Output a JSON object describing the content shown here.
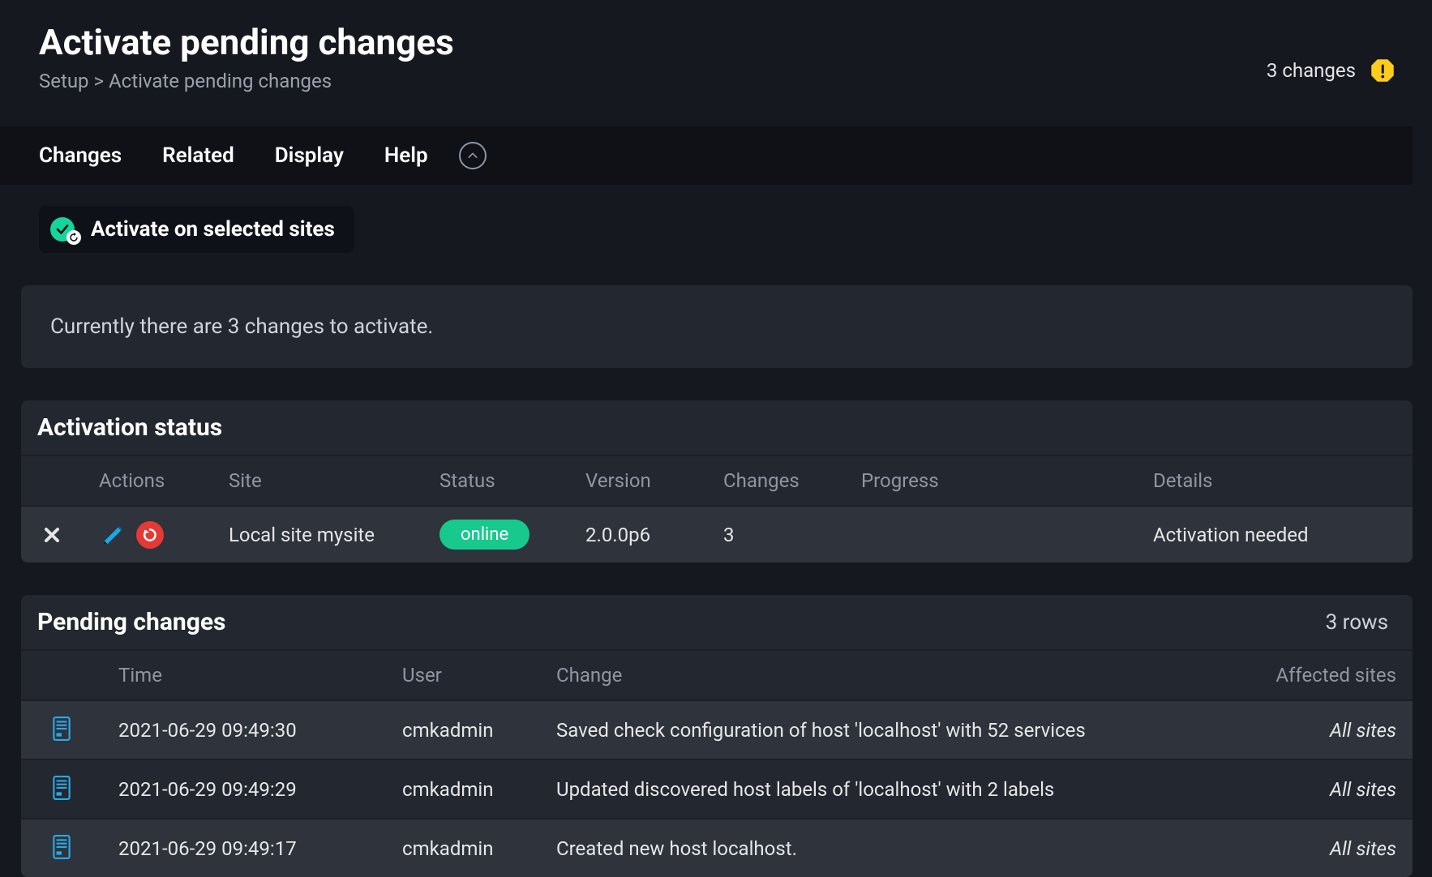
{
  "header": {
    "title": "Activate pending changes",
    "breadcrumb": "Setup > Activate pending changes",
    "changes_label": "3 changes"
  },
  "menubar": {
    "items": [
      "Changes",
      "Related",
      "Display",
      "Help"
    ]
  },
  "activate_button": {
    "label": "Activate on selected sites"
  },
  "info_panel": {
    "text": "Currently there are 3 changes to activate."
  },
  "activation_status": {
    "title": "Activation status",
    "columns": {
      "actions": "Actions",
      "site": "Site",
      "status": "Status",
      "version": "Version",
      "changes": "Changes",
      "progress": "Progress",
      "details": "Details"
    },
    "rows": [
      {
        "site": "Local site mysite",
        "status": "online",
        "version": "2.0.0p6",
        "changes": "3",
        "progress": "",
        "details": "Activation needed"
      }
    ]
  },
  "pending_changes": {
    "title": "Pending changes",
    "rows_label": "3 rows",
    "columns": {
      "time": "Time",
      "user": "User",
      "change": "Change",
      "affected": "Affected sites"
    },
    "rows": [
      {
        "time": "2021-06-29 09:49:30",
        "user": "cmkadmin",
        "change": "Saved check configuration of host 'localhost' with 52 services",
        "affected": "All sites"
      },
      {
        "time": "2021-06-29 09:49:29",
        "user": "cmkadmin",
        "change": "Updated discovered host labels of 'localhost' with 2 labels",
        "affected": "All sites"
      },
      {
        "time": "2021-06-29 09:49:17",
        "user": "cmkadmin",
        "change": "Created new host localhost.",
        "affected": "All sites"
      }
    ]
  }
}
